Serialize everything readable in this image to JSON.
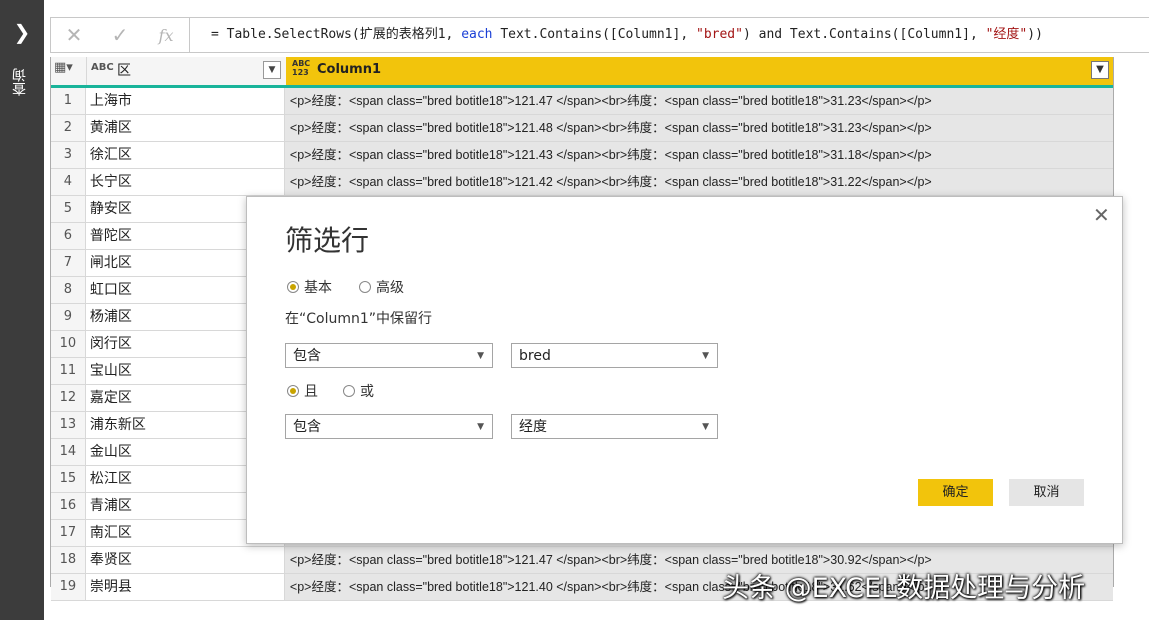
{
  "sidebar": {
    "expand_icon": "chevron-right-icon",
    "label": "查询"
  },
  "formula_bar": {
    "cancel_icon": "close-icon",
    "commit_icon": "checkmark-icon",
    "fx_label": "fx",
    "formula_parts": {
      "p1": "= Table.SelectRows(扩展的表格列1, ",
      "kw_each": "each",
      "p2": " Text.Contains([Column1], ",
      "s1": "\"bred\"",
      "p3": ") and Text.Contains([Column1], ",
      "s2": "\"经度\"",
      "p4": "))"
    }
  },
  "grid": {
    "col0": {
      "type_label": "ABC",
      "name": "区"
    },
    "col1": {
      "type_top": "ABC",
      "type_bottom": "123",
      "name": "Column1"
    },
    "rows": [
      {
        "n": "1",
        "area": "上海市",
        "text": "<p>经度：<span class=\"bred botitle18\">121.47 </span><br>纬度：<span class=\"bred botitle18\">31.23</span></p>"
      },
      {
        "n": "2",
        "area": "黄浦区",
        "text": "<p>经度：<span class=\"bred botitle18\">121.48 </span><br>纬度：<span class=\"bred botitle18\">31.23</span></p>"
      },
      {
        "n": "3",
        "area": "徐汇区",
        "text": "<p>经度：<span class=\"bred botitle18\">121.43 </span><br>纬度：<span class=\"bred botitle18\">31.18</span></p>"
      },
      {
        "n": "4",
        "area": "长宁区",
        "text": "<p>经度：<span class=\"bred botitle18\">121.42 </span><br>纬度：<span class=\"bred botitle18\">31.22</span></p>"
      },
      {
        "n": "5",
        "area": "静安区",
        "text": ""
      },
      {
        "n": "6",
        "area": "普陀区",
        "text": ""
      },
      {
        "n": "7",
        "area": "闸北区",
        "text": ""
      },
      {
        "n": "8",
        "area": "虹口区",
        "text": ""
      },
      {
        "n": "9",
        "area": "杨浦区",
        "text": ""
      },
      {
        "n": "10",
        "area": "闵行区",
        "text": ""
      },
      {
        "n": "11",
        "area": "宝山区",
        "text": ""
      },
      {
        "n": "12",
        "area": "嘉定区",
        "text": ""
      },
      {
        "n": "13",
        "area": "浦东新区",
        "text": ""
      },
      {
        "n": "14",
        "area": "金山区",
        "text": ""
      },
      {
        "n": "15",
        "area": "松江区",
        "text": ""
      },
      {
        "n": "16",
        "area": "青浦区",
        "text": ""
      },
      {
        "n": "17",
        "area": "南汇区",
        "text": ""
      },
      {
        "n": "18",
        "area": "奉贤区",
        "text": "<p>经度：<span class=\"bred botitle18\">121.47 </span><br>纬度：<span class=\"bred botitle18\">30.92</span></p>"
      },
      {
        "n": "19",
        "area": "崇明县",
        "text": "<p>经度：<span class=\"bred botitle18\">121.40 </span><br>纬度：<span class=\"bred botitle18\">31.62</span></p>"
      }
    ]
  },
  "dialog": {
    "title": "筛选行",
    "close_icon": "close-icon",
    "mode_basic": "基本",
    "mode_advanced": "高级",
    "description": "在“Column1”中保留行",
    "cond1_operator": "包含",
    "cond1_value": "bred",
    "logic_and": "且",
    "logic_or": "或",
    "cond2_operator": "包含",
    "cond2_value": "经度",
    "ok_label": "确定",
    "cancel_label": "取消"
  },
  "watermark": "头条 @EXCEL数据处理与分析",
  "colors": {
    "accent": "#f2c40c",
    "teal": "#19b49a",
    "sidebar": "#3c3c3c"
  }
}
